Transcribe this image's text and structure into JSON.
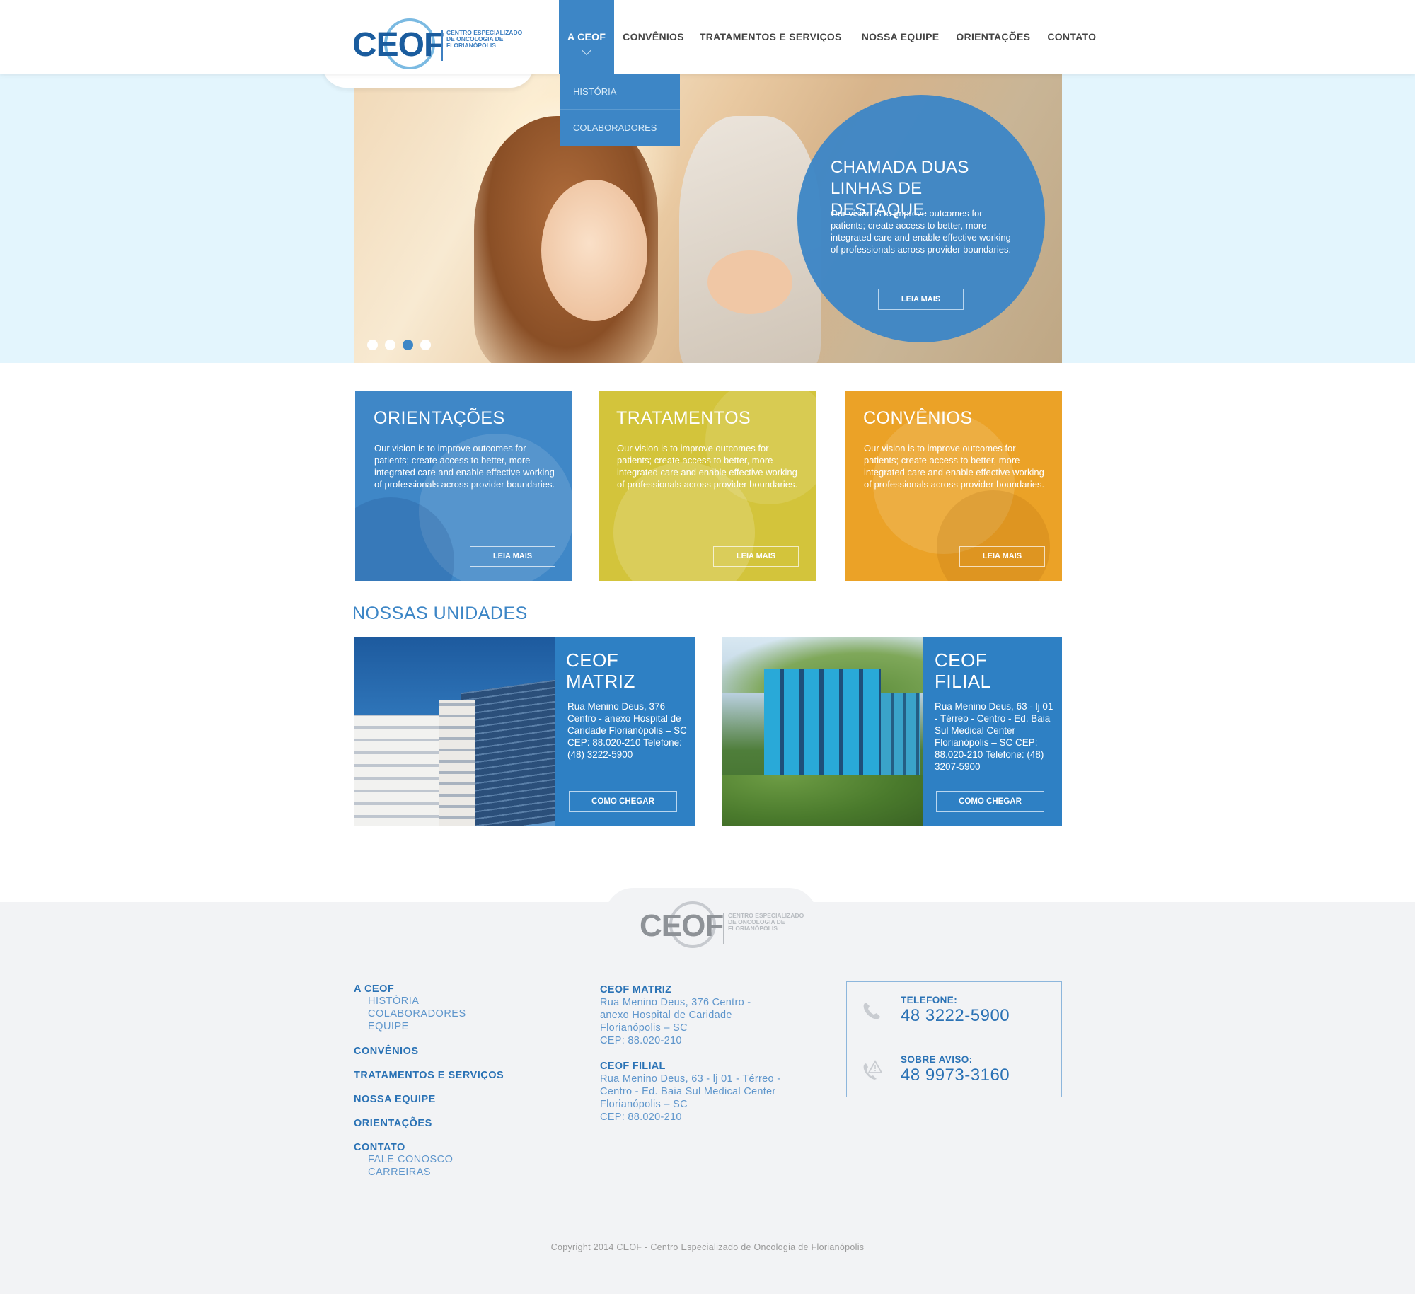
{
  "logo": {
    "word": "CEOF",
    "subtitle": "CENTRO ESPECIALIZADO DE ONCOLOGIA DE FLORIANÓPOLIS"
  },
  "nav": {
    "items": [
      {
        "label": "A CEOF",
        "active": true
      },
      {
        "label": "CONVÊNIOS"
      },
      {
        "label": "TRATAMENTOS E SERVIÇOS"
      },
      {
        "label": "NOSSA EQUIPE"
      },
      {
        "label": "ORIENTAÇÕES"
      },
      {
        "label": "CONTATO"
      }
    ],
    "dropdown": [
      "HISTÓRIA",
      "COLABORADORES"
    ]
  },
  "hero": {
    "title": "CHAMADA DUAS LINHAS DE DESTAQUE",
    "text": "Our vision is to improve outcomes for patients; create access to better, more integrated care and enable effective working of professionals across provider boundaries.",
    "button": "LEIA MAIS",
    "slide_count": 4,
    "active_slide": 3
  },
  "cards": [
    {
      "title": "ORIENTAÇÕES",
      "text": "Our vision is to improve outcomes for patients; create access to better, more integrated care and enable effective working of professionals across provider boundaries.",
      "button": "LEIA MAIS",
      "color": "#3f87c7"
    },
    {
      "title": "TRATAMENTOS",
      "text": "Our vision is to improve outcomes for patients; create access to better, more integrated care and enable effective working of professionals across provider boundaries.",
      "button": "LEIA MAIS",
      "color": "#d3c43b"
    },
    {
      "title": "CONVÊNIOS",
      "text": "Our vision is to improve outcomes for patients; create access to better, more integrated care and enable effective working of professionals across provider boundaries.",
      "button": "LEIA MAIS",
      "color": "#eba227"
    }
  ],
  "units": {
    "section_title": "NOSSAS UNIDADES",
    "items": [
      {
        "title_line1": "CEOF",
        "title_line2": "MATRIZ",
        "address": "Rua Menino Deus, 376 Centro  - anexo Hospital de Caridade Florianópolis – SC CEP: 88.020-210 Telefone: (48) 3222-5900",
        "button": "COMO CHEGAR"
      },
      {
        "title_line1": "CEOF",
        "title_line2": "FILIAL",
        "address": "Rua Menino Deus, 63 - lj 01 - Térreo - Centro  - Ed. Baia Sul Medical Center Florianópolis – SC CEP: 88.020-210 Telefone: (48) 3207-5900",
        "button": "COMO CHEGAR"
      }
    ]
  },
  "footer": {
    "nav": [
      {
        "head": "A CEOF",
        "subs": [
          "HISTÓRIA",
          "COLABORADORES",
          "EQUIPE"
        ]
      },
      {
        "head": "CONVÊNIOS",
        "subs": []
      },
      {
        "head": "TRATAMENTOS E SERVIÇOS",
        "subs": []
      },
      {
        "head": "NOSSA EQUIPE",
        "subs": []
      },
      {
        "head": "ORIENTAÇÕES",
        "subs": []
      },
      {
        "head": "CONTATO",
        "subs": [
          "FALE CONOSCO",
          "CARREIRAS"
        ]
      }
    ],
    "addresses": [
      {
        "head": "CEOF MATRIZ",
        "lines": [
          "Rua Menino Deus, 376 Centro  -",
          "anexo Hospital de Caridade",
          "Florianópolis – SC",
          "CEP: 88.020-210"
        ]
      },
      {
        "head": "CEOF FILIAL",
        "lines": [
          "Rua Menino Deus, 63 - lj 01 - Térreo -",
          "Centro  - Ed. Baia Sul Medical Center",
          "Florianópolis – SC",
          "CEP: 88.020-210"
        ]
      }
    ],
    "contacts": [
      {
        "label": "TELEFONE:",
        "number": "48 3222-5900",
        "icon": "phone-icon"
      },
      {
        "label": "SOBRE AVISO:",
        "number": "48 9973-3160",
        "icon": "phone-alert-icon"
      }
    ],
    "copyright": "Copyright 2014 CEOF - Centro Especializado de Oncologia de Florianópolis"
  },
  "colors": {
    "brand_blue": "#3d86c6",
    "hero_bg": "#e3f5fd",
    "footer_bg": "#f2f3f5"
  }
}
